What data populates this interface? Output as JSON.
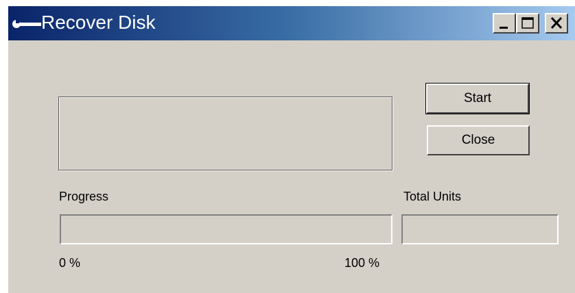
{
  "window": {
    "title": "Recover Disk",
    "icon": "wrench-icon",
    "controls": {
      "minimize": "minimize-icon",
      "maximize": "maximize-icon",
      "close": "close-icon"
    }
  },
  "buttons": {
    "start": "Start",
    "close": "Close"
  },
  "progress": {
    "label": "Progress",
    "value": 0,
    "min_label": "0 %",
    "max_label": "100 %"
  },
  "total_units": {
    "label": "Total Units",
    "value": ""
  },
  "colors": {
    "title_start": "#0a246a",
    "title_end": "#a6caf0",
    "face": "#d4d0c8",
    "progress_fill": "#0a246a"
  }
}
